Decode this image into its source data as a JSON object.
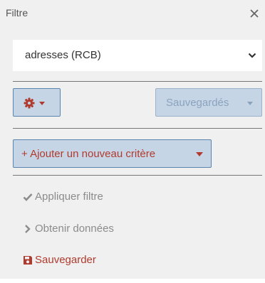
{
  "panel": {
    "title": "Filtre",
    "close_icon": "close-icon"
  },
  "select": {
    "value": "adresses (RCB)",
    "icon": "chevron-down-icon"
  },
  "toolbar": {
    "gear_icon": "gear-icon",
    "saved_label": "Sauvegardés"
  },
  "add_criterion": {
    "label": "+ Ajouter un nouveau critère"
  },
  "actions": [
    {
      "label": "Appliquer filtre",
      "icon": "check-icon",
      "enabled": false
    },
    {
      "label": "Obtenir données",
      "icon": "chevron-right-icon",
      "enabled": false
    },
    {
      "label": "Sauvegarder",
      "icon": "floppy-disk-icon",
      "enabled": true
    }
  ],
  "colors": {
    "panel_bg": "#f0f0f0",
    "button_bg": "#c6d5e6",
    "button_border": "#5a84b0",
    "accent_red": "#b03a2e",
    "muted_text": "#8c8c8c"
  }
}
